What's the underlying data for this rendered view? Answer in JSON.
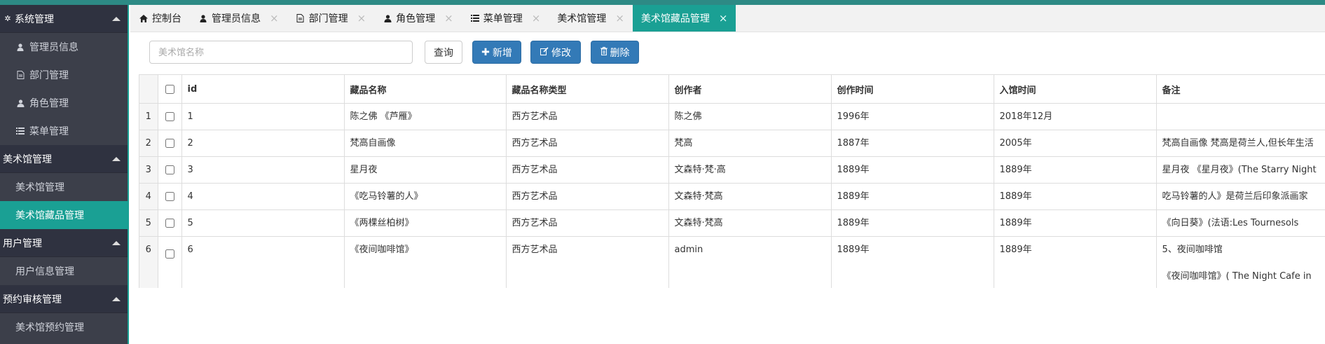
{
  "sidebar": {
    "groups": [
      {
        "label": "系统管理",
        "icon": "gear-icon",
        "items": [
          {
            "label": "管理员信息",
            "icon": "user-icon"
          },
          {
            "label": "部门管理",
            "icon": "document-icon"
          },
          {
            "label": "角色管理",
            "icon": "users-icon"
          },
          {
            "label": "菜单管理",
            "icon": "list-icon"
          }
        ]
      },
      {
        "label": "美术馆管理",
        "items": [
          {
            "label": "美术馆管理"
          },
          {
            "label": "美术馆藏品管理",
            "active": true
          }
        ]
      },
      {
        "label": "用户管理",
        "items": [
          {
            "label": "用户信息管理"
          }
        ]
      },
      {
        "label": "预约审核管理",
        "items": [
          {
            "label": "美术馆预约管理"
          }
        ]
      }
    ]
  },
  "tabs": [
    {
      "label": "控制台",
      "icon": "home-icon"
    },
    {
      "label": "管理员信息",
      "icon": "user-icon"
    },
    {
      "label": "部门管理",
      "icon": "document-icon"
    },
    {
      "label": "角色管理",
      "icon": "users-icon"
    },
    {
      "label": "菜单管理",
      "icon": "list-icon"
    },
    {
      "label": "美术馆管理"
    },
    {
      "label": "美术馆藏品管理",
      "active": true
    }
  ],
  "toolbar": {
    "search_placeholder": "美术馆名称",
    "query_label": "查询",
    "add_label": "新增",
    "edit_label": "修改",
    "delete_label": "删除"
  },
  "table": {
    "columns": [
      "id",
      "藏品名称",
      "藏品名称类型",
      "创作者",
      "创作时间",
      "入馆时间",
      "备注"
    ],
    "rows": [
      {
        "n": "1",
        "id": "1",
        "name": "陈之佛 《芦雁》",
        "type": "西方艺术品",
        "author": "陈之佛",
        "created": "1996年",
        "entered": "2018年12月",
        "note": ""
      },
      {
        "n": "2",
        "id": "2",
        "name": "梵高自画像",
        "type": "西方艺术品",
        "author": "梵高",
        "created": "1887年",
        "entered": "2005年",
        "note": "梵高自画像 梵高是荷兰人,但长年生活"
      },
      {
        "n": "3",
        "id": "3",
        "name": "星月夜",
        "type": "西方艺术品",
        "author": "文森特·梵·高",
        "created": "1889年",
        "entered": "1889年",
        "note": "星月夜 《星月夜》(The Starry Night"
      },
      {
        "n": "4",
        "id": "4",
        "name": "《吃马铃薯的人》",
        "type": "西方艺术品",
        "author": "文森特·梵高",
        "created": "1889年",
        "entered": "1889年",
        "note": "吃马铃薯的人》是荷兰后印象派画家"
      },
      {
        "n": "5",
        "id": "5",
        "name": "《两棵丝柏树》",
        "type": "西方艺术品",
        "author": "文森特·梵高",
        "created": "1889年",
        "entered": "1889年",
        "note": "《向日葵》(法语:Les Tournesols"
      },
      {
        "n": "6",
        "id": "6",
        "name": "《夜间咖啡馆》",
        "type": "西方艺术品",
        "author": "admin",
        "created": "1889年",
        "entered": "1889年",
        "note": "5、夜间咖啡馆",
        "note2": "《夜间咖啡馆》( The Night Cafe in"
      }
    ]
  },
  "colors": {
    "accent": "#1aa094",
    "sidebar_bg": "#3c3f4a",
    "primary": "#337ab7",
    "topbar": "#2d8a85"
  }
}
